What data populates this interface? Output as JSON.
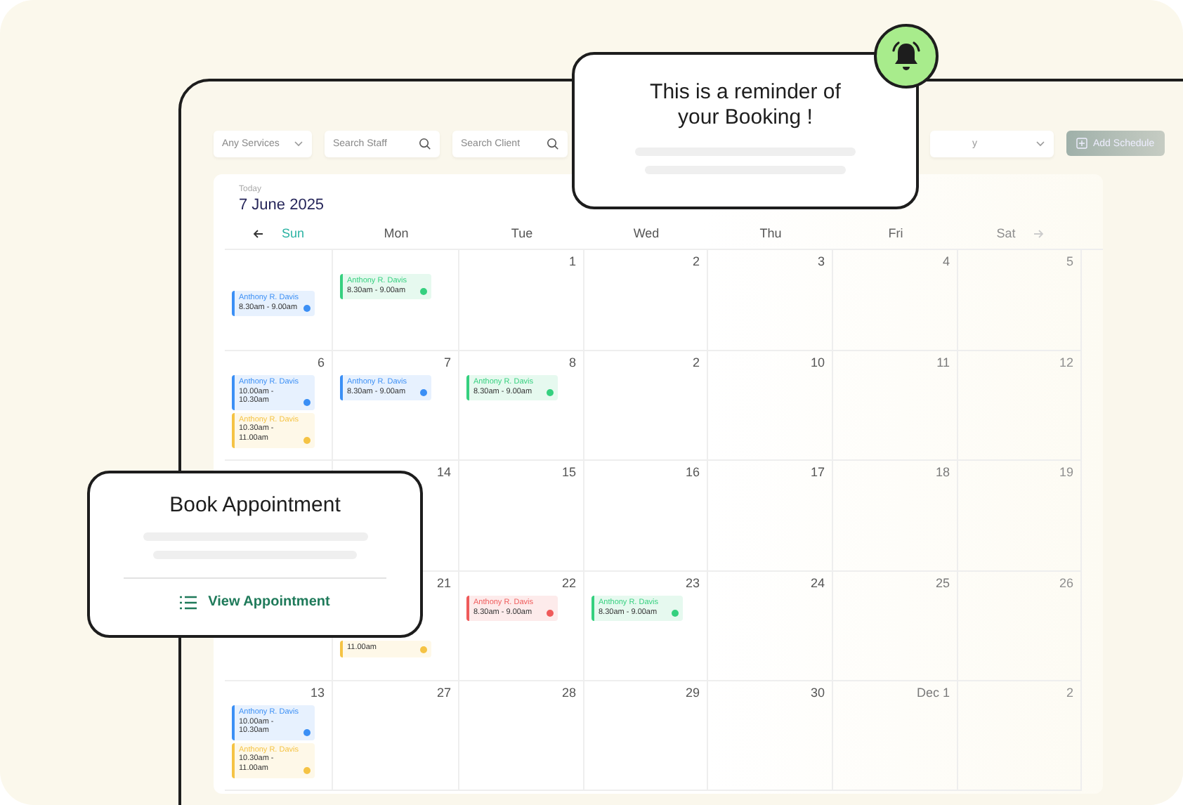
{
  "toolbar": {
    "services_dropdown": {
      "value": "Any Services"
    },
    "staff_search": {
      "placeholder": "Search Staff"
    },
    "client_search": {
      "placeholder": "Search Client"
    },
    "dropdown_2": {
      "value": "y"
    },
    "add_button": "Add Schedule"
  },
  "calendar": {
    "today_label": "Today",
    "date": "7 June 2025",
    "weekdays": [
      {
        "label": "Sun",
        "selected": true
      },
      {
        "label": "Mon",
        "selected": false
      },
      {
        "label": "Tue",
        "selected": false
      },
      {
        "label": "Wed",
        "selected": false
      },
      {
        "label": "Thu",
        "selected": false
      },
      {
        "label": "Fri",
        "selected": false
      },
      {
        "label": "Sat",
        "selected": false
      }
    ],
    "weeks": [
      [
        {
          "events": [
            {
              "name": "Anthony R. Davis",
              "time": "8.30am - 9.00am",
              "color": "#3b8ff5"
            }
          ]
        },
        {
          "events": [
            {
              "name": "Anthony R. Davis",
              "time": "8.30am - 9.00am",
              "color": "#35d07f"
            }
          ]
        },
        {
          "date": "1"
        },
        {
          "date": "2"
        },
        {
          "date": "3"
        },
        {
          "date": "4"
        },
        {
          "date": "5"
        }
      ],
      [
        {
          "date": "6",
          "events": [
            {
              "name": "Anthony R. Davis",
              "time": "10.00am - 10.30am",
              "color": "#3b8ff5"
            },
            {
              "name": "Anthony R. Davis",
              "time": "10.30am - 11.00am",
              "color": "#f5c344"
            }
          ]
        },
        {
          "date": "7",
          "events": [
            {
              "name": "Anthony R. Davis",
              "time": "8.30am - 9.00am",
              "color": "#3b8ff5"
            }
          ]
        },
        {
          "date": "8",
          "events": [
            {
              "name": "Anthony R. Davis",
              "time": "8.30am - 9.00am",
              "color": "#35d07f"
            }
          ]
        },
        {
          "date": "2"
        },
        {
          "date": "10"
        },
        {
          "date": "11"
        },
        {
          "date": "12"
        }
      ],
      [
        {
          "date": "14"
        },
        {
          "date": "15"
        },
        {
          "date": "16"
        },
        {
          "date": "17"
        },
        {
          "date": "18"
        },
        {
          "date": "19"
        }
      ],
      [
        {
          "date": "21",
          "events": [
            {
              "time": "11.00am",
              "color": "#f5c344"
            }
          ]
        },
        {
          "date": "22",
          "events": [
            {
              "name": "Anthony R. Davis",
              "time": "8.30am - 9.00am",
              "color": "#ef5a5a"
            }
          ]
        },
        {
          "date": "23",
          "events": [
            {
              "name": "Anthony R. Davis",
              "time": "8.30am - 9.00am",
              "color": "#35d07f"
            }
          ]
        },
        {
          "date": "24"
        },
        {
          "date": "25"
        },
        {
          "date": "26"
        }
      ],
      [
        {
          "date": "13",
          "events": [
            {
              "name": "Anthony R. Davis",
              "time": "10.00am - 10.30am",
              "color": "#3b8ff5"
            },
            {
              "name": "Anthony R. Davis",
              "time": "10.30am - 11.00am",
              "color": "#f5c344"
            }
          ]
        },
        {
          "date": "27"
        },
        {
          "date": "28"
        },
        {
          "date": "29"
        },
        {
          "date": "30"
        },
        {
          "date": "Dec 1"
        },
        {
          "date": "2"
        }
      ]
    ]
  },
  "reminder_popup": {
    "title": "This is a reminder of your Booking !"
  },
  "book_popup": {
    "title": "Book Appointment",
    "action": "View Appointment"
  }
}
